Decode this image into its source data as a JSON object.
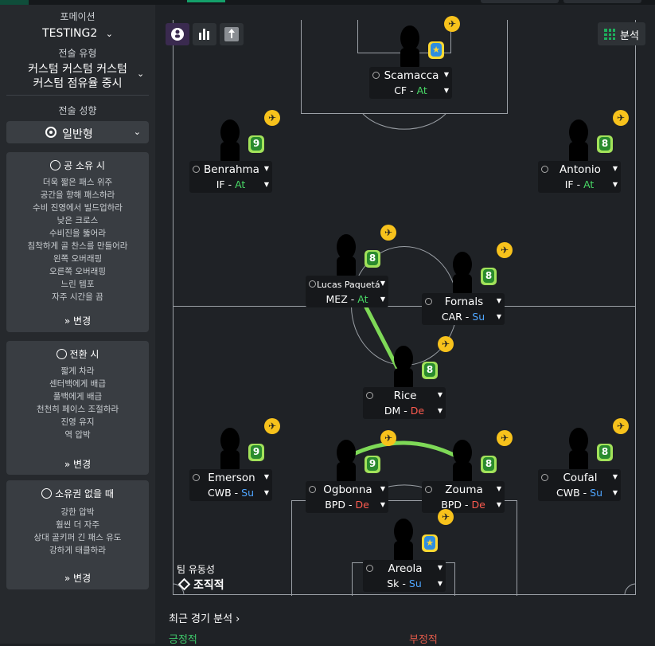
{
  "sidebar": {
    "formation_label": "포메이션",
    "formation_value": "TESTING2",
    "tactic_label": "전술 유형",
    "tactic_value_line1": "커스텀 커스텀 커스텀",
    "tactic_value_line2": "커스텀 점유율 중시",
    "mentality_label": "전술 성향",
    "mentality_value": "일반형",
    "in_possession": {
      "title": "공 소유 시",
      "items": [
        "더욱 짧은 패스 위주",
        "공간을 향해 패스하라",
        "수비 진영에서 빌드업하라",
        "낮은 크로스",
        "수비진을 뚫어라",
        "침착하게 골 찬스를 만들어라",
        "왼쪽 오버래핑",
        "오른쪽 오버래핑",
        "느린 템포",
        "자주 시간을 끔"
      ],
      "change": "변경"
    },
    "in_transition": {
      "title": "전환 시",
      "items": [
        "짧게 차라",
        "센터백에게 배급",
        "풀백에게 배급",
        "천천히 페이스 조절하라",
        "진영 유지",
        "역 압박"
      ],
      "change": "변경"
    },
    "out_of_possession": {
      "title": "소유권 없을 때",
      "items": [
        "강한 압박",
        "훨씬 더 자주",
        "상대 골키퍼 긴 패스 유도",
        "강하게 태클하라"
      ],
      "change": "변경"
    }
  },
  "toolbar": {
    "analysis_label": "분석"
  },
  "players": [
    {
      "name": "Scamacca",
      "role": "CF",
      "duty": "At",
      "badge": "★",
      "badge_type": "star"
    },
    {
      "name": "Benrahma",
      "role": "IF",
      "duty": "At",
      "badge": "9",
      "badge_type": "green"
    },
    {
      "name": "Antonio",
      "role": "IF",
      "duty": "At",
      "badge": "8",
      "badge_type": "green"
    },
    {
      "name": "Lucas Paquetá",
      "role": "MEZ",
      "duty": "At",
      "badge": "8",
      "badge_type": "green"
    },
    {
      "name": "Fornals",
      "role": "CAR",
      "duty": "Su",
      "badge": "8",
      "badge_type": "green"
    },
    {
      "name": "Rice",
      "role": "DM",
      "duty": "De",
      "badge": "8",
      "badge_type": "green"
    },
    {
      "name": "Emerson",
      "role": "CWB",
      "duty": "Su",
      "badge": "9",
      "badge_type": "green"
    },
    {
      "name": "Ogbonna",
      "role": "BPD",
      "duty": "De",
      "badge": "9",
      "badge_type": "green"
    },
    {
      "name": "Zouma",
      "role": "BPD",
      "duty": "De",
      "badge": "8",
      "badge_type": "green"
    },
    {
      "name": "Coufal",
      "role": "CWB",
      "duty": "Su",
      "badge": "8",
      "badge_type": "green"
    },
    {
      "name": "Areola",
      "role": "Sk",
      "duty": "Su",
      "badge": "★",
      "badge_type": "star"
    }
  ],
  "fluidity": {
    "label": "팀 유동성",
    "value": "조직적"
  },
  "recent": {
    "title": "최근 경기 분석",
    "positive": "긍정적",
    "negative": "부정적"
  }
}
